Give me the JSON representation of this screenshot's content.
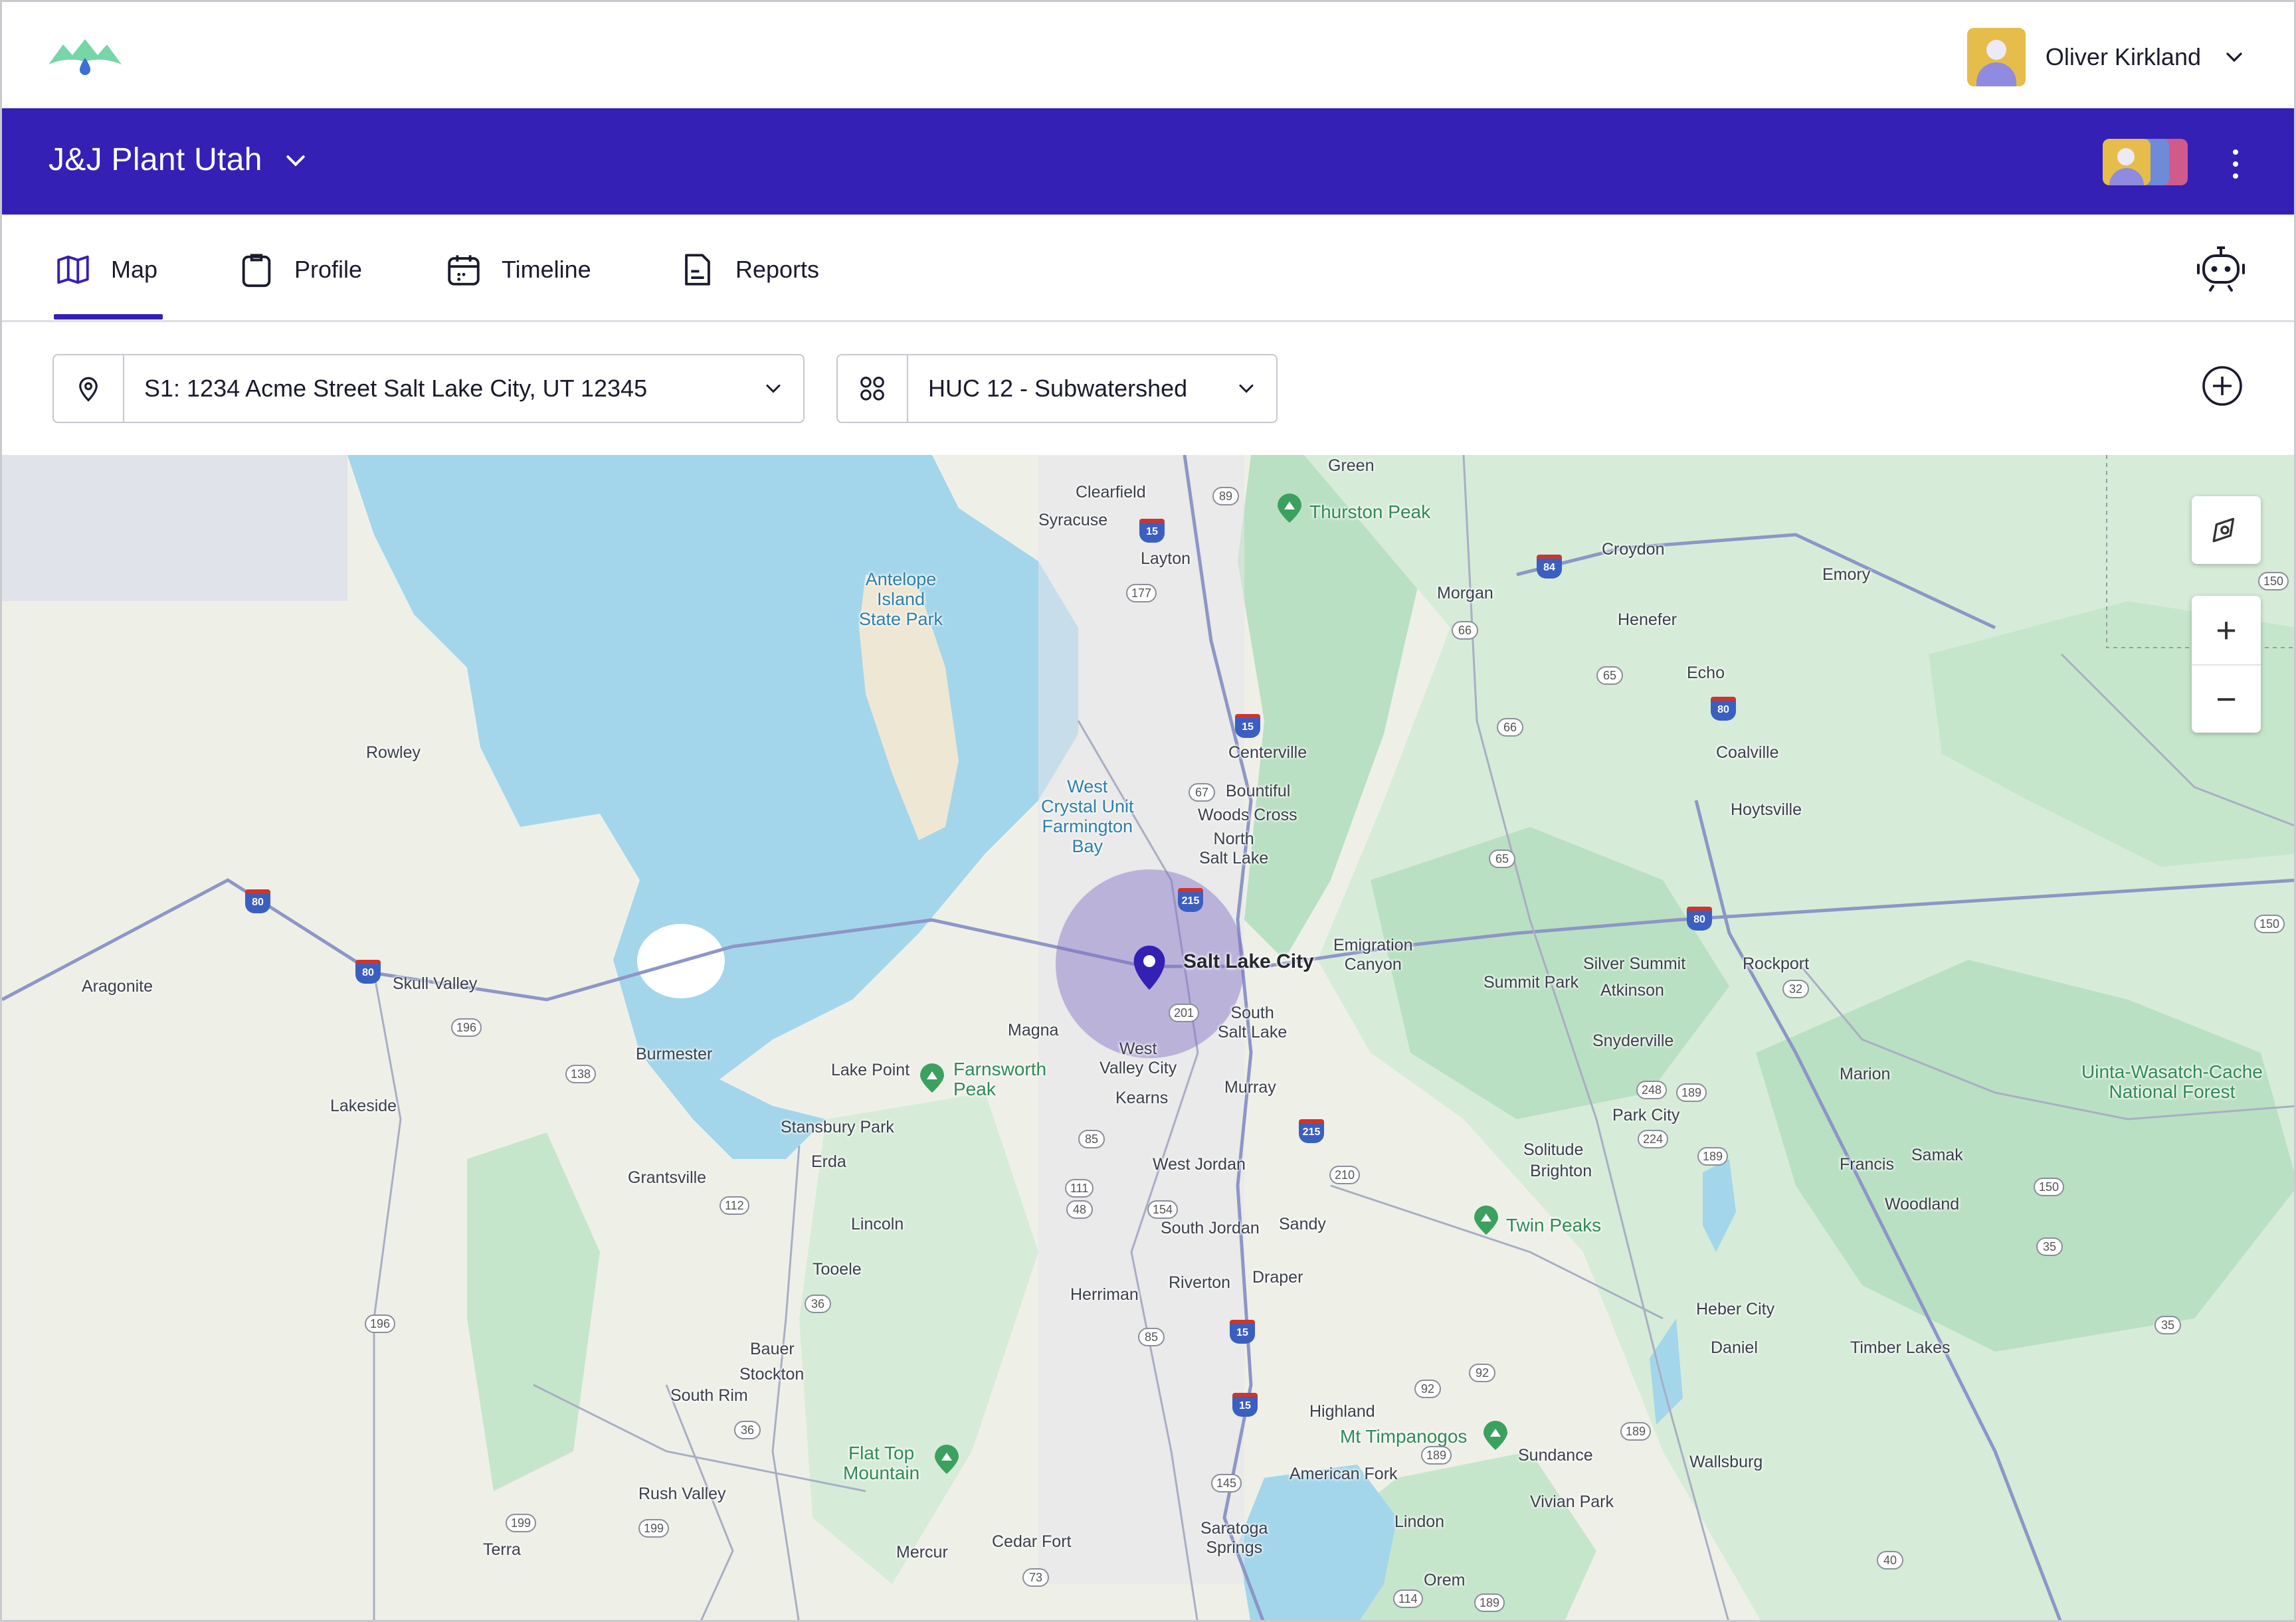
{
  "user": {
    "name": "Oliver Kirkland"
  },
  "org": {
    "name": "J&J Plant Utah"
  },
  "tabs": [
    {
      "label": "Map",
      "icon": "map-icon",
      "active": true
    },
    {
      "label": "Profile",
      "icon": "clipboard-icon",
      "active": false
    },
    {
      "label": "Timeline",
      "icon": "calendar-icon",
      "active": false
    },
    {
      "label": "Reports",
      "icon": "report-icon",
      "active": false
    }
  ],
  "filters": {
    "site": "S1: 1234 Acme Street Salt Lake City, UT 12345",
    "layer": "HUC 12 - Subwatershed"
  },
  "colors": {
    "brand": "#3420b4",
    "accent": "#3420b4",
    "water": "#a3d6ea",
    "forest": "#b9e0c2"
  },
  "map": {
    "zoom_in": "+",
    "zoom_out": "−",
    "labels": {
      "green": "Green",
      "clearfield": "Clearfield",
      "syracuse": "Syracuse",
      "layton": "Layton",
      "thurston": "Thurston Peak",
      "croydon": "Croydon",
      "morgan": "Morgan",
      "emory": "Emory",
      "henefer": "Henefer",
      "echo": "Echo",
      "antelope": "Antelope\nIsland\nState Park",
      "rowley": "Rowley",
      "centerville": "Centerville",
      "bountiful": "Bountiful",
      "woodscross": "Woods Cross",
      "northslc": "North\nSalt Lake",
      "coalville": "Coalville",
      "hoytsville": "Hoytsville",
      "westcrystal": "West\nCrystal Unit\nFarmington\nBay",
      "slc": "Salt Lake City",
      "emigration": "Emigration\nCanyon",
      "silversummit": "Silver Summit",
      "rockport": "Rockport",
      "summitpark": "Summit Park",
      "atkinson": "Atkinson",
      "aragonite": "Aragonite",
      "skullvalley": "Skull Valley",
      "magna": "Magna",
      "southslc": "South\nSalt Lake",
      "westvalley": "West\nValley City",
      "burmester": "Burmester",
      "lakepoint": "Lake Point",
      "farnsworth": "Farnsworth\nPeak",
      "kearns": "Kearns",
      "murray": "Murray",
      "snyderville": "Snyderville",
      "marion": "Marion",
      "uinta": "Uinta-Wasatch-Cache\nNational Forest",
      "lakeside": "Lakeside",
      "stansbury": "Stansbury Park",
      "parkcity": "Park City",
      "erda": "Erda",
      "westjordan": "West Jordan",
      "solitude": "Solitude",
      "brighton": "Brighton",
      "francis": "Francis",
      "samak": "Samak",
      "grantsville": "Grantsville",
      "woodland": "Woodland",
      "lincoln": "Lincoln",
      "southjordan": "South Jordan",
      "sandy": "Sandy",
      "twinpeaks": "Twin Peaks",
      "tooele": "Tooele",
      "draper": "Draper",
      "riverton": "Riverton",
      "herriman": "Herriman",
      "hebercity": "Heber City",
      "daniel": "Daniel",
      "timberlakes": "Timber Lakes",
      "bauer": "Bauer",
      "stockton": "Stockton",
      "southrim": "South Rim",
      "highland": "Highland",
      "mttimpanogos": "Mt Timpanogos",
      "sundance": "Sundance",
      "wallsburg": "Wallsburg",
      "flattop": "Flat Top\nMountain",
      "americanfork": "American Fork",
      "rushvalley": "Rush Valley",
      "vivianpark": "Vivian Park",
      "terra": "Terra",
      "mercur": "Mercur",
      "cedarfort": "Cedar Fort",
      "saratoga": "Saratoga\nSprings",
      "lindon": "Lindon",
      "orem": "Orem"
    },
    "shields": [
      "89",
      "15",
      "177",
      "84",
      "66",
      "65",
      "66",
      "80",
      "150",
      "67",
      "15",
      "215",
      "65",
      "80",
      "150",
      "80",
      "201",
      "196",
      "138",
      "32",
      "248",
      "189",
      "224",
      "215",
      "189",
      "85",
      "111",
      "48",
      "154",
      "210",
      "112",
      "150",
      "35",
      "196",
      "36",
      "85",
      "15",
      "92",
      "92",
      "189",
      "35",
      "36",
      "189",
      "15",
      "145",
      "199",
      "199",
      "73",
      "114",
      "189",
      "40",
      "80"
    ]
  }
}
